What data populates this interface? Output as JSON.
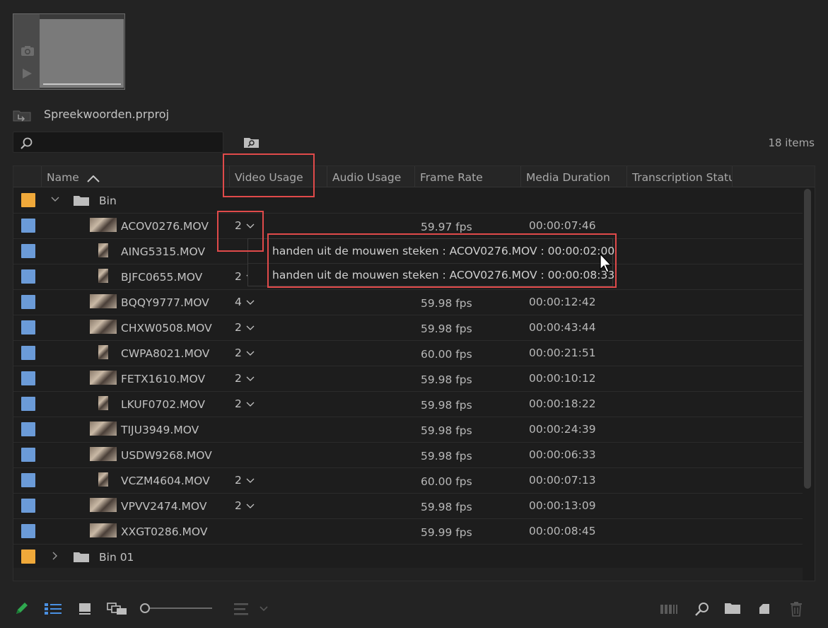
{
  "project": {
    "name": "Spreekwoorden.prproj",
    "item_count": "18 items"
  },
  "search": {
    "placeholder": "",
    "value": ""
  },
  "columns": {
    "name": "Name",
    "video_usage": "Video Usage",
    "audio_usage": "Audio Usage",
    "frame_rate": "Frame Rate",
    "media_duration": "Media Duration",
    "transcription_status": "Transcription Statu"
  },
  "bins": [
    {
      "name": "Bin",
      "color": "#f0a93a",
      "expanded": true
    },
    {
      "name": "Bin 01",
      "color": "#f0a93a",
      "expanded": false
    }
  ],
  "clips": [
    {
      "name": "ACOV0276.MOV",
      "video_usage": "2",
      "frame_rate": "59.97 fps",
      "duration": "00:00:07:46",
      "orientation": "landscape"
    },
    {
      "name": "AING5315.MOV",
      "video_usage": "",
      "frame_rate": "",
      "duration": "",
      "orientation": "portrait"
    },
    {
      "name": "BJFC0655.MOV",
      "video_usage": "2",
      "frame_rate": "",
      "duration": "",
      "orientation": "portrait"
    },
    {
      "name": "BQQY9777.MOV",
      "video_usage": "4",
      "frame_rate": "59.98 fps",
      "duration": "00:00:12:42",
      "orientation": "landscape"
    },
    {
      "name": "CHXW0508.MOV",
      "video_usage": "2",
      "frame_rate": "59.98 fps",
      "duration": "00:00:43:44",
      "orientation": "landscape"
    },
    {
      "name": "CWPA8021.MOV",
      "video_usage": "2",
      "frame_rate": "60.00 fps",
      "duration": "00:00:21:51",
      "orientation": "portrait"
    },
    {
      "name": "FETX1610.MOV",
      "video_usage": "2",
      "frame_rate": "59.98 fps",
      "duration": "00:00:10:12",
      "orientation": "landscape"
    },
    {
      "name": "LKUF0702.MOV",
      "video_usage": "2",
      "frame_rate": "59.98 fps",
      "duration": "00:00:18:22",
      "orientation": "portrait"
    },
    {
      "name": "TIJU3949.MOV",
      "video_usage": "",
      "frame_rate": "59.98 fps",
      "duration": "00:00:24:39",
      "orientation": "landscape"
    },
    {
      "name": "USDW9268.MOV",
      "video_usage": "",
      "frame_rate": "59.98 fps",
      "duration": "00:00:06:33",
      "orientation": "landscape"
    },
    {
      "name": "VCZM4604.MOV",
      "video_usage": "2",
      "frame_rate": "60.00 fps",
      "duration": "00:00:07:13",
      "orientation": "portrait"
    },
    {
      "name": "VPVV2474.MOV",
      "video_usage": "2",
      "frame_rate": "59.98 fps",
      "duration": "00:00:13:09",
      "orientation": "landscape"
    },
    {
      "name": "XXGT0286.MOV",
      "video_usage": "",
      "frame_rate": "59.99 fps",
      "duration": "00:00:08:45",
      "orientation": "landscape"
    }
  ],
  "clip_label_color": "#6b9bd8",
  "usage_popup": {
    "items": [
      "handen uit de mouwen steken : ACOV0276.MOV : 00:00:02:00",
      "handen uit de mouwen steken : ACOV0276.MOV : 00:00:08:33"
    ]
  },
  "highlight_color": "#e04a4a",
  "icons": {
    "pencil": "pencil-icon",
    "list_view": "list-view-icon",
    "icon_view": "icon-view-icon",
    "freeform_view": "freeform-view-icon",
    "sort": "sort-icons-icon",
    "automate": "automate-to-sequence-icon",
    "find": "find-icon",
    "new_bin": "new-bin-icon",
    "new_item": "new-item-icon",
    "clear": "trash-icon"
  }
}
